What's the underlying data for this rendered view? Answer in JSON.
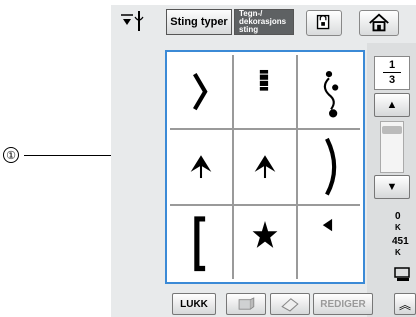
{
  "callout": {
    "number": "①"
  },
  "toolbar": {
    "tab_utility": "Sting typer",
    "tab_decorative": "Tegn-/ dekorasjons sting"
  },
  "page": {
    "current": "1",
    "total": "3"
  },
  "side_info": {
    "width_value": "0",
    "width_unit": "K",
    "length_value": "451",
    "length_unit": "K"
  },
  "bottom": {
    "close_label": "LUKK",
    "edit_label": "REDIGER"
  },
  "stitches": [
    {
      "icon": "bracket-right-stitch-icon"
    },
    {
      "icon": "satin-bar-stitch-icon"
    },
    {
      "icon": "scroll-dots-stitch-icon"
    },
    {
      "icon": "tree-stitch-icon"
    },
    {
      "icon": "tree-stitch-icon"
    },
    {
      "icon": "curve-stitch-icon"
    },
    {
      "icon": "bracket-left-stitch-icon"
    },
    {
      "icon": "star-stitch-icon"
    },
    {
      "icon": "leaf-stitch-icon"
    }
  ]
}
